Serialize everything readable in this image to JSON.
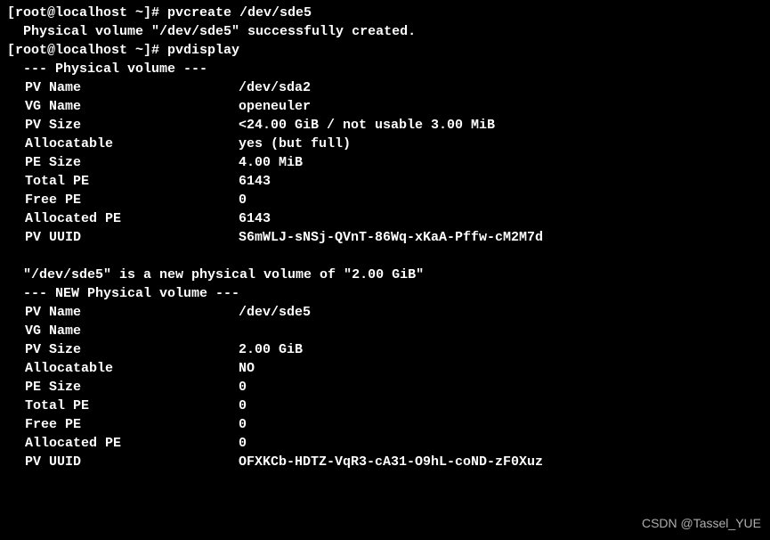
{
  "prompt1": "[root@localhost ~]# ",
  "cmd1": "pvcreate /dev/sde5",
  "msg1": "  Physical volume \"/dev/sde5\" successfully created.",
  "prompt2": "[root@localhost ~]# ",
  "cmd2": "pvdisplay",
  "header1": "  --- Physical volume ---",
  "pv1": {
    "name_label": "PV Name",
    "name_value": "/dev/sda2",
    "vg_label": "VG Name",
    "vg_value": "openeuler",
    "size_label": "PV Size",
    "size_value": "<24.00 GiB / not usable 3.00 MiB",
    "alloc_label": "Allocatable",
    "alloc_value": "yes (but full)",
    "pe_label": "PE Size",
    "pe_value": "4.00 MiB",
    "total_label": "Total PE",
    "total_value": "6143",
    "free_label": "Free PE",
    "free_value": "0",
    "allocpe_label": "Allocated PE",
    "allocpe_value": "6143",
    "uuid_label": "PV UUID",
    "uuid_value": "S6mWLJ-sNSj-QVnT-86Wq-xKaA-Pffw-cM2M7d"
  },
  "newmsg": "  \"/dev/sde5\" is a new physical volume of \"2.00 GiB\"",
  "header2": "  --- NEW Physical volume ---",
  "pv2": {
    "name_label": "PV Name",
    "name_value": "/dev/sde5",
    "vg_label": "VG Name",
    "vg_value": "",
    "size_label": "PV Size",
    "size_value": "2.00 GiB",
    "alloc_label": "Allocatable",
    "alloc_value": "NO",
    "pe_label": "PE Size",
    "pe_value": "0",
    "total_label": "Total PE",
    "total_value": "0",
    "free_label": "Free PE",
    "free_value": "0",
    "allocpe_label": "Allocated PE",
    "allocpe_value": "0",
    "uuid_label": "PV UUID",
    "uuid_value": "OFXKCb-HDTZ-VqR3-cA31-O9hL-coND-zF0Xuz"
  },
  "watermark": "CSDN @Tassel_YUE"
}
